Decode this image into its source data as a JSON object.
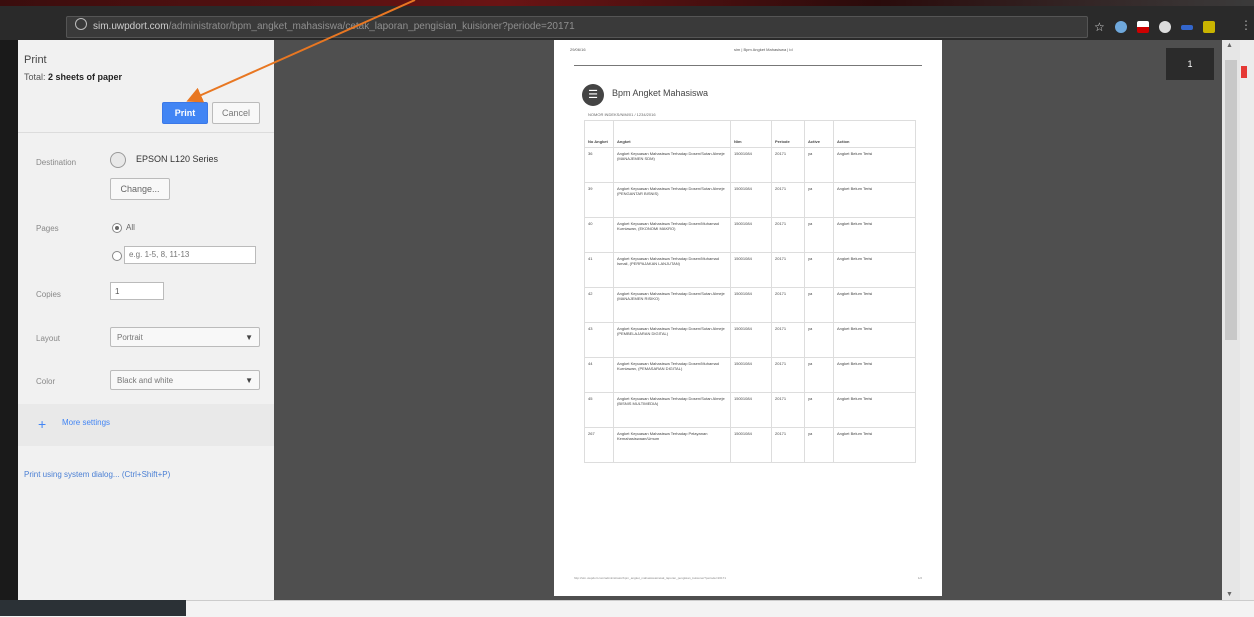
{
  "browser": {
    "url_host": "sim.uwpdort.com",
    "url_path": "/administrator/bpm_angket_mahasiswa/cetak_laporan_pengisian_kuisioner?periode=20171"
  },
  "print_panel": {
    "title": "Print",
    "total_prefix": "Total: ",
    "total_value": "2 sheets of paper",
    "print_button": "Print",
    "cancel_button": "Cancel",
    "destination_label": "Destination",
    "destination_value": "EPSON L120 Series",
    "change_button": "Change...",
    "pages_label": "Pages",
    "pages_all": "All",
    "pages_placeholder": "e.g. 1-5, 8, 11-13",
    "copies_label": "Copies",
    "copies_value": "1",
    "layout_label": "Layout",
    "layout_value": "Portrait",
    "color_label": "Color",
    "color_value": "Black and white",
    "more_settings": "More settings",
    "system_dialog": "Print using system dialog... (Ctrl+Shift+P)"
  },
  "document": {
    "header_left": "29/06/16",
    "header_center": "sim | Bpm Angket Mahasiswa | id",
    "title": "Bpm Angket Mahasiswa",
    "subtitle": "NOMOR INDEKS/NIM/01 / 1234/2016",
    "columns": [
      "No Angket",
      "Angket",
      "Nim",
      "Periode",
      "Active",
      "Action"
    ],
    "rows": [
      {
        "no": "36",
        "angket": "Angket Kepuasan Mahasiswa Terhadap Dosen/Sutan Almeje (MANAJEMEN SDM)",
        "nim": "15001084",
        "periode": "20171",
        "active": "ya",
        "action": "Angket Belum Terisi"
      },
      {
        "no": "39",
        "angket": "Angket Kepuasan Mahasiswa Terhadap Dosen/Sutan Almeje (PENGANTAR BISNIS)",
        "nim": "15001084",
        "periode": "20171",
        "active": "ya",
        "action": "Angket Belum Terisi"
      },
      {
        "no": "40",
        "angket": "Angket Kepuasan Mahasiswa Terhadap Dosen/Muhamad Kurniawan, (EKONOMI MAKRO)",
        "nim": "15001084",
        "periode": "20171",
        "active": "ya",
        "action": "Angket Belum Terisi"
      },
      {
        "no": "41",
        "angket": "Angket Kepuasan Mahasiswa Terhadap Dosen/Muhamad Ismail, (PERPAJAKAN LANJUTAN)",
        "nim": "15001084",
        "periode": "20171",
        "active": "ya",
        "action": "Angket Belum Terisi"
      },
      {
        "no": "42",
        "angket": "Angket Kepuasan Mahasiswa Terhadap Dosen/Sutan Almeje (MANAJEMEN RISIKO)",
        "nim": "15001084",
        "periode": "20171",
        "active": "ya",
        "action": "Angket Belum Terisi"
      },
      {
        "no": "43",
        "angket": "Angket Kepuasan Mahasiswa Terhadap Dosen/Sutan Almeje (PEMBELAJARAN DIGITAL)",
        "nim": "15001084",
        "periode": "20171",
        "active": "ya",
        "action": "Angket Belum Terisi"
      },
      {
        "no": "44",
        "angket": "Angket Kepuasan Mahasiswa Terhadap Dosen/Muhamad Kurniawan, (PEMASARAN DIGITAL)",
        "nim": "15001084",
        "periode": "20171",
        "active": "ya",
        "action": "Angket Belum Terisi"
      },
      {
        "no": "45",
        "angket": "Angket Kepuasan Mahasiswa Terhadap Dosen/Sutan Almeje (BISNIS MULTIMEDIA)",
        "nim": "15001084",
        "periode": "20171",
        "active": "ya",
        "action": "Angket Belum Terisi"
      },
      {
        "no": "267",
        "angket": "Angket Kepuasan Mahasiswa Terhadap Pelayanan Kemahasiswaan/Umum",
        "nim": "15001084",
        "periode": "20171",
        "active": "ya",
        "action": "Angket Belum Terisi"
      }
    ],
    "footer_left": "http://sim.uwpdort.com/administrator/bpm_angket_mahasiswa/cetak_laporan_pengisian_kuisioner?periode=20171",
    "footer_right": "1/2"
  },
  "overlay": {
    "badge": "1"
  },
  "colors": {
    "accent": "#4285f4",
    "arrow": "#e87722"
  }
}
